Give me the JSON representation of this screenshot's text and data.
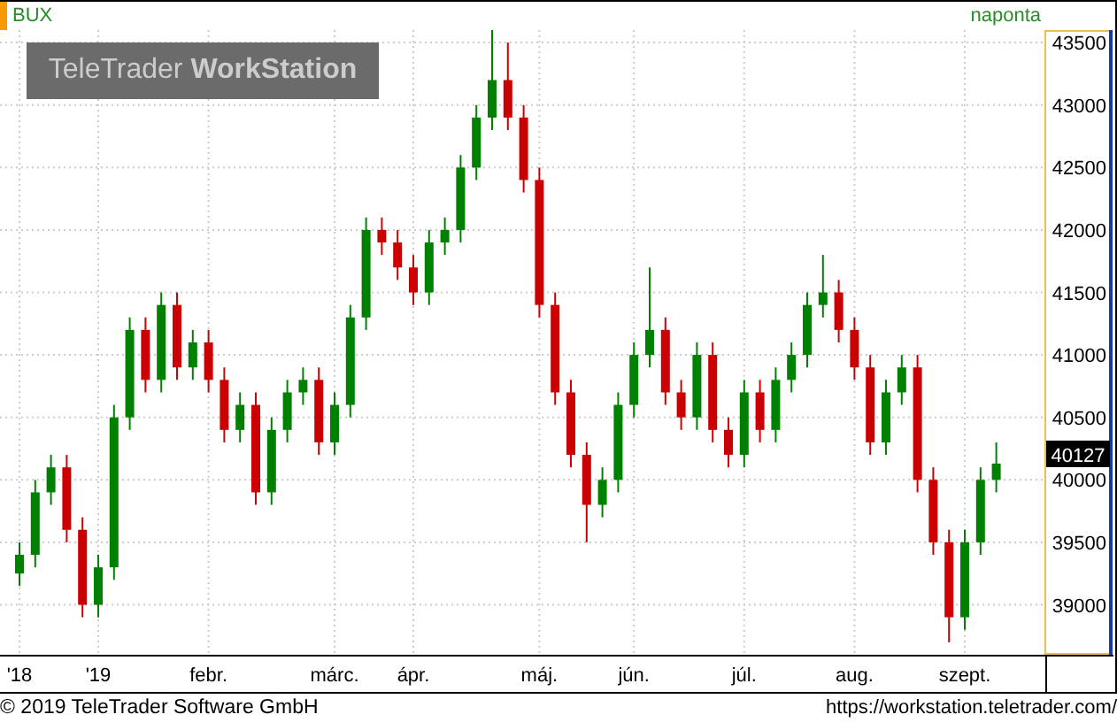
{
  "header": {
    "interval": "naponta"
  },
  "logo": {
    "text": "TeleTrader **WorkStation**"
  },
  "chart_data": {
    "type": "candlestick",
    "title": "BUX",
    "grid": true,
    "ylim": [
      38600,
      43600
    ],
    "yticks": [
      39000,
      39500,
      40000,
      40500,
      41000,
      41500,
      42000,
      42500,
      43000,
      43500
    ],
    "categories": [
      "'18",
      null,
      null,
      null,
      null,
      "'19",
      null,
      null,
      null,
      null,
      null,
      null,
      "febr.",
      null,
      null,
      null,
      null,
      null,
      null,
      null,
      "márc.",
      null,
      null,
      null,
      null,
      "ápr.",
      null,
      null,
      null,
      null,
      null,
      null,
      null,
      "máj.",
      null,
      null,
      null,
      null,
      null,
      "jún.",
      null,
      null,
      null,
      null,
      null,
      null,
      "júl.",
      null,
      null,
      null,
      null,
      null,
      null,
      "aug.",
      null,
      null,
      null,
      null,
      null,
      null,
      "szept.",
      null,
      null
    ],
    "ohlc": [
      [
        39250,
        39500,
        39150,
        39400
      ],
      [
        39400,
        40000,
        39300,
        39900
      ],
      [
        39900,
        40200,
        39800,
        40100
      ],
      [
        40100,
        40200,
        39500,
        39600
      ],
      [
        39600,
        39700,
        38900,
        39000
      ],
      [
        39000,
        39400,
        38900,
        39300
      ],
      [
        39300,
        40600,
        39200,
        40500
      ],
      [
        40500,
        41300,
        40400,
        41200
      ],
      [
        41200,
        41300,
        40700,
        40800
      ],
      [
        40800,
        41500,
        40700,
        41400
      ],
      [
        41400,
        41500,
        40800,
        40900
      ],
      [
        40900,
        41200,
        40800,
        41100
      ],
      [
        41100,
        41200,
        40700,
        40800
      ],
      [
        40800,
        40900,
        40300,
        40400
      ],
      [
        40400,
        40700,
        40300,
        40600
      ],
      [
        40600,
        40700,
        39800,
        39900
      ],
      [
        39900,
        40500,
        39800,
        40400
      ],
      [
        40400,
        40800,
        40300,
        40700
      ],
      [
        40700,
        40900,
        40600,
        40800
      ],
      [
        40800,
        40900,
        40200,
        40300
      ],
      [
        40300,
        40700,
        40200,
        40600
      ],
      [
        40600,
        41400,
        40500,
        41300
      ],
      [
        41300,
        42100,
        41200,
        42000
      ],
      [
        42000,
        42100,
        41800,
        41900
      ],
      [
        41900,
        42000,
        41600,
        41700
      ],
      [
        41700,
        41800,
        41400,
        41500
      ],
      [
        41500,
        42000,
        41400,
        41900
      ],
      [
        41900,
        42100,
        41800,
        42000
      ],
      [
        42000,
        42600,
        41900,
        42500
      ],
      [
        42500,
        43000,
        42400,
        42900
      ],
      [
        42900,
        43600,
        42800,
        43200
      ],
      [
        43200,
        43500,
        42800,
        42900
      ],
      [
        42900,
        43000,
        42300,
        42400
      ],
      [
        42400,
        42500,
        41300,
        41400
      ],
      [
        41400,
        41500,
        40600,
        40700
      ],
      [
        40700,
        40800,
        40100,
        40200
      ],
      [
        40200,
        40300,
        39500,
        39800
      ],
      [
        39800,
        40100,
        39700,
        40000
      ],
      [
        40000,
        40700,
        39900,
        40600
      ],
      [
        40600,
        41100,
        40500,
        41000
      ],
      [
        41000,
        41700,
        40900,
        41200
      ],
      [
        41200,
        41300,
        40600,
        40700
      ],
      [
        40700,
        40800,
        40400,
        40500
      ],
      [
        40500,
        41100,
        40400,
        41000
      ],
      [
        41000,
        41100,
        40300,
        40400
      ],
      [
        40400,
        40500,
        40100,
        40200
      ],
      [
        40200,
        40800,
        40100,
        40700
      ],
      [
        40700,
        40800,
        40300,
        40400
      ],
      [
        40400,
        40900,
        40300,
        40800
      ],
      [
        40800,
        41100,
        40700,
        41000
      ],
      [
        41000,
        41500,
        40900,
        41400
      ],
      [
        41400,
        41800,
        41300,
        41500
      ],
      [
        41500,
        41600,
        41100,
        41200
      ],
      [
        41200,
        41300,
        40800,
        40900
      ],
      [
        40900,
        41000,
        40200,
        40300
      ],
      [
        40300,
        40800,
        40200,
        40700
      ],
      [
        40700,
        41000,
        40600,
        40900
      ],
      [
        40900,
        41000,
        39900,
        40000
      ],
      [
        40000,
        40100,
        39400,
        39500
      ],
      [
        39500,
        39600,
        38700,
        38900
      ],
      [
        38900,
        39600,
        38800,
        39500
      ],
      [
        39500,
        40100,
        39400,
        40000
      ],
      [
        40000,
        40300,
        39900,
        40130
      ]
    ]
  },
  "last_price": "40127",
  "footer": {
    "copyright": "© 2019 TeleTrader Software GmbH",
    "url": "https://workstation.teletrader.com/"
  }
}
